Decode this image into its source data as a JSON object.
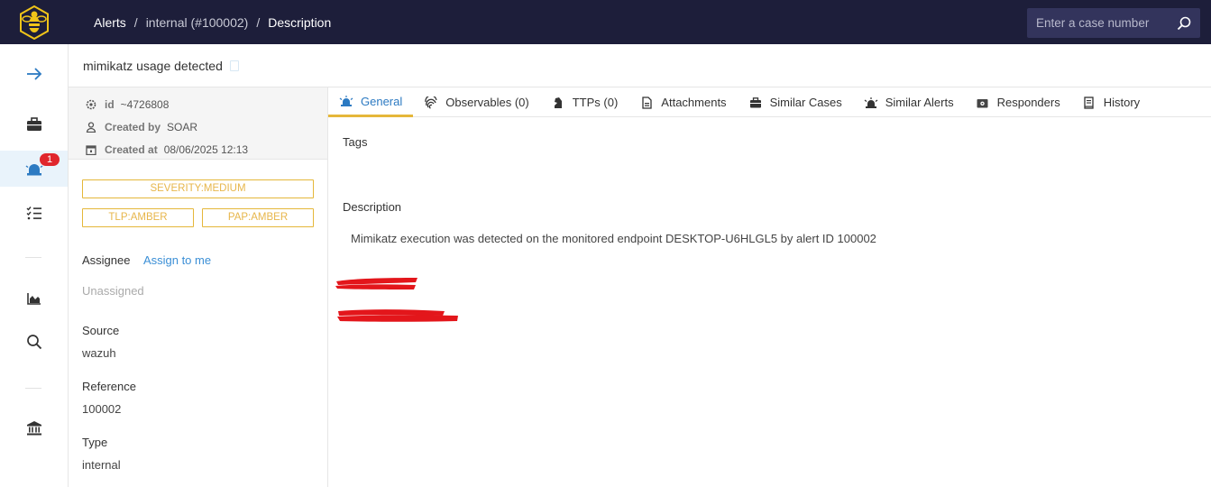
{
  "header": {
    "breadcrumb": [
      "Alerts",
      "internal (#100002)",
      "Description"
    ],
    "search_placeholder": "Enter a case number"
  },
  "nav": {
    "items": [
      {
        "icon": "arrow-right-icon"
      },
      {
        "icon": "briefcase-icon"
      },
      {
        "icon": "alert-siren-icon",
        "badge": "1"
      },
      {
        "icon": "tasks-list-icon"
      },
      {
        "icon": "dashboard-chart-icon"
      },
      {
        "icon": "search-icon"
      },
      {
        "icon": "bank-icon"
      }
    ]
  },
  "alert": {
    "title": "mimikatz usage detected",
    "meta": {
      "id_label": "id",
      "id_value": "~4726808",
      "created_by_label": "Created by",
      "created_by_value": "SOAR",
      "created_at_label": "Created at",
      "created_at_value": "08/06/2025 12:13"
    },
    "tags": {
      "severity": "SEVERITY:MEDIUM",
      "tlp": "TLP:AMBER",
      "pap": "PAP:AMBER"
    },
    "fields": {
      "assignee_label": "Assignee",
      "assign_to_me": "Assign to me",
      "assignee_value": "Unassigned",
      "source_label": "Source",
      "source_value": "wazuh",
      "reference_label": "Reference",
      "reference_value": "100002",
      "type_label": "Type",
      "type_value": "internal"
    }
  },
  "tabs": [
    {
      "label": "General",
      "icon": "siren-icon",
      "active": true
    },
    {
      "label": "Observables (0)",
      "icon": "fingerprint-icon"
    },
    {
      "label": "TTPs (0)",
      "icon": "chess-knight-icon"
    },
    {
      "label": "Attachments",
      "icon": "file-icon"
    },
    {
      "label": "Similar Cases",
      "icon": "briefcase-icon"
    },
    {
      "label": "Similar Alerts",
      "icon": "siren-icon"
    },
    {
      "label": "Responders",
      "icon": "cog-box-icon"
    },
    {
      "label": "History",
      "icon": "book-icon"
    }
  ],
  "general": {
    "tags_label": "Tags",
    "description_label": "Description",
    "description_text": "Mimikatz execution was detected on the monitored endpoint DESKTOP-U6HLGL5 by alert ID 100002"
  },
  "colors": {
    "topbar": "#1d1e3a",
    "accent_yellow": "#e5b73a",
    "link_blue": "#3b8fd6",
    "redaction_red": "#e3161b"
  }
}
